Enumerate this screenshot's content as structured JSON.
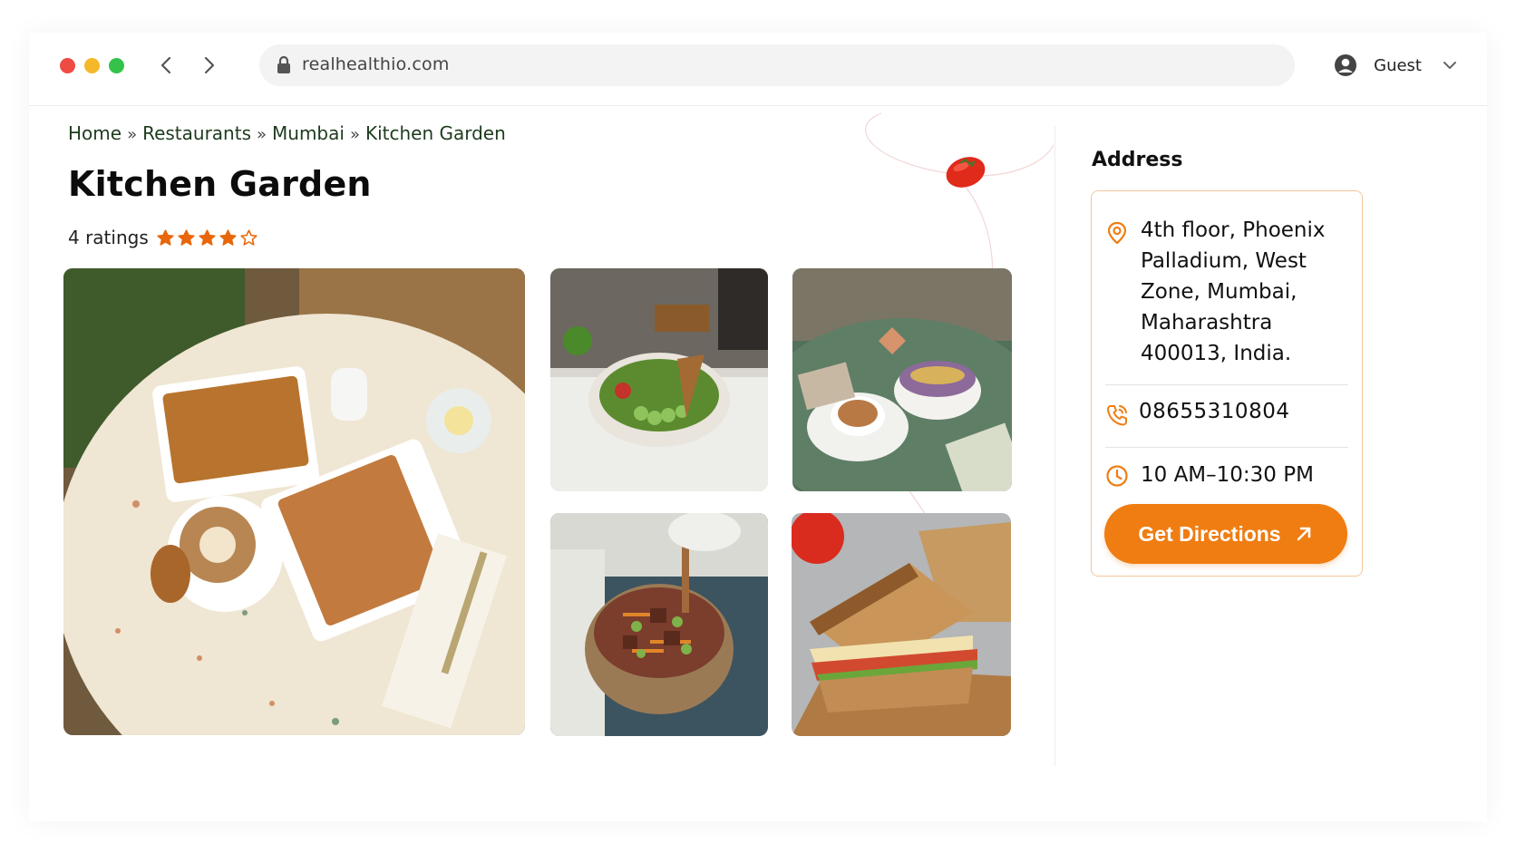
{
  "browser": {
    "url": "realhealthio.com",
    "user_label": "Guest"
  },
  "breadcrumb": [
    "Home",
    "Restaurants",
    "Mumbai",
    "Kitchen Garden"
  ],
  "breadcrumb_separator": "»",
  "restaurant": {
    "name": "Kitchen Garden",
    "ratings_label": "4 ratings",
    "rating": 4,
    "rating_max": 5
  },
  "gallery": [
    {
      "name": "photo-waffles-coffee"
    },
    {
      "name": "photo-salad-bowl"
    },
    {
      "name": "photo-latte-smoothie-bowl"
    },
    {
      "name": "photo-tofu-noodle-bowl"
    },
    {
      "name": "photo-sandwich"
    }
  ],
  "address_panel": {
    "heading": "Address",
    "address": "4th floor, Phoenix Palladium, West Zone, Mumbai, Maharashtra 400013, India.",
    "phone": "08655310804",
    "hours": "10 AM–10:30 PM",
    "directions_label": "Get Directions"
  },
  "colors": {
    "accent": "#ef7d12",
    "star": "#e8670a",
    "breadcrumb": "#1d3b1d",
    "card_border": "#f2c79a"
  },
  "icons": {
    "lock": "lock-icon",
    "user": "user-circle-icon",
    "location": "map-pin-icon",
    "phone": "phone-icon",
    "clock": "clock-icon",
    "directions": "arrow-up-right-icon"
  }
}
